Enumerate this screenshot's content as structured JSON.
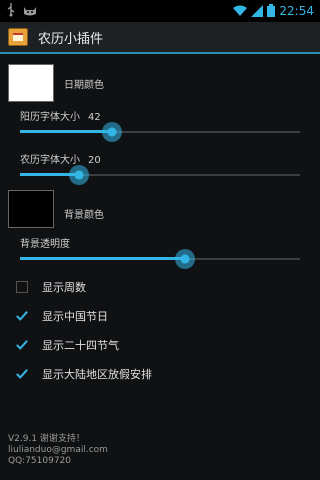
{
  "status_bar": {
    "time": "22:54",
    "icons": [
      "usb-icon",
      "cat-icon",
      "wifi-icon",
      "signal-icon",
      "battery-icon"
    ]
  },
  "action_bar": {
    "title": "农历小插件",
    "icon": "calendar-icon"
  },
  "date_color": {
    "label": "日期颜色",
    "swatch_color": "#ffffff"
  },
  "solar_font_size": {
    "label": "阳历字体大小",
    "value": "42",
    "level": 0.33
  },
  "lunar_font_size": {
    "label": "农历字体大小",
    "value": "20",
    "level": 0.21
  },
  "background_color": {
    "label": "背景颜色",
    "swatch_color": "#000000"
  },
  "background_opacity": {
    "label": "背景透明度",
    "level": 0.59
  },
  "checkboxes": [
    {
      "label": "显示周数",
      "checked": false
    },
    {
      "label": "显示中国节日",
      "checked": true
    },
    {
      "label": "显示二十四节气",
      "checked": true
    },
    {
      "label": "显示大陆地区放假安排",
      "checked": true
    }
  ],
  "footer": {
    "version_line": "V2.9.1 谢谢支持！",
    "email": "liulianduo@gmail.com",
    "qq": "QQ:75109720"
  },
  "colors": {
    "accent": "#33b5e5",
    "background": "#0f1113"
  }
}
